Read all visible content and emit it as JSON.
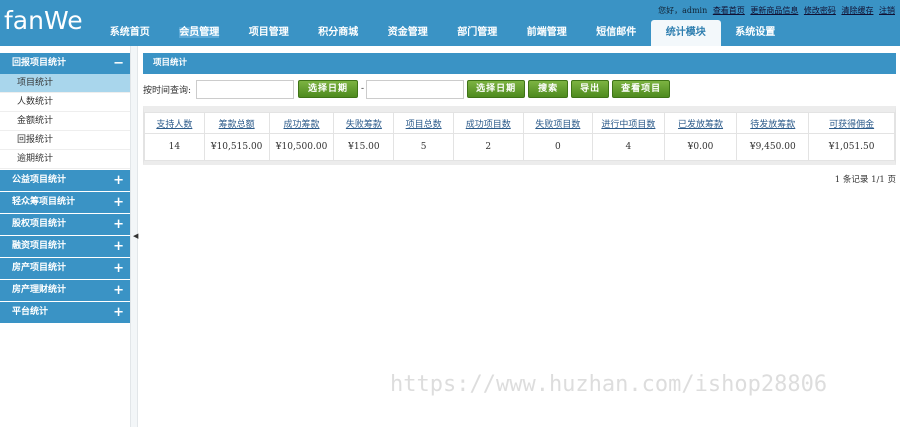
{
  "header": {
    "logo": "fanWe",
    "greeting": "您好，admin",
    "links": [
      "查看首页",
      "更新商品信息",
      "修改密码",
      "清除缓存",
      "注销"
    ],
    "nav": [
      "系统首页",
      "会员管理",
      "项目管理",
      "积分商城",
      "资金管理",
      "部门管理",
      "前端管理",
      "短信邮件",
      "统计模块",
      "系统设置"
    ],
    "active_nav": "统计模块"
  },
  "sidebar": {
    "open_section": "回报项目统计",
    "open_items": [
      "项目统计",
      "人数统计",
      "金额统计",
      "回报统计",
      "逾期统计"
    ],
    "selected": "项目统计",
    "sections": [
      "公益项目统计",
      "轻众筹项目统计",
      "股权项目统计",
      "融资项目统计",
      "房产项目统计",
      "房产理财统计",
      "平台统计"
    ]
  },
  "main": {
    "title": "项目统计",
    "filter_label": "按时间查询:",
    "date_btn": "选择日期",
    "dash": "-",
    "search_btn": "搜索",
    "export_btn": "导出",
    "view_btn": "查看项目",
    "columns": [
      "支持人数",
      "筹款总额",
      "成功筹款",
      "失败筹款",
      "项目总数",
      "成功项目数",
      "失败项目数",
      "进行中项目数",
      "已发放筹款",
      "待发放筹款",
      "可获得佣金"
    ],
    "rows": [
      [
        "14",
        "¥10,515.00",
        "¥10,500.00",
        "¥15.00",
        "5",
        "2",
        "0",
        "4",
        "¥0.00",
        "¥9,450.00",
        "¥1,051.50"
      ]
    ],
    "pager": "1 条记录 1/1 页"
  },
  "watermark": "https://www.huzhan.com/ishop28806"
}
